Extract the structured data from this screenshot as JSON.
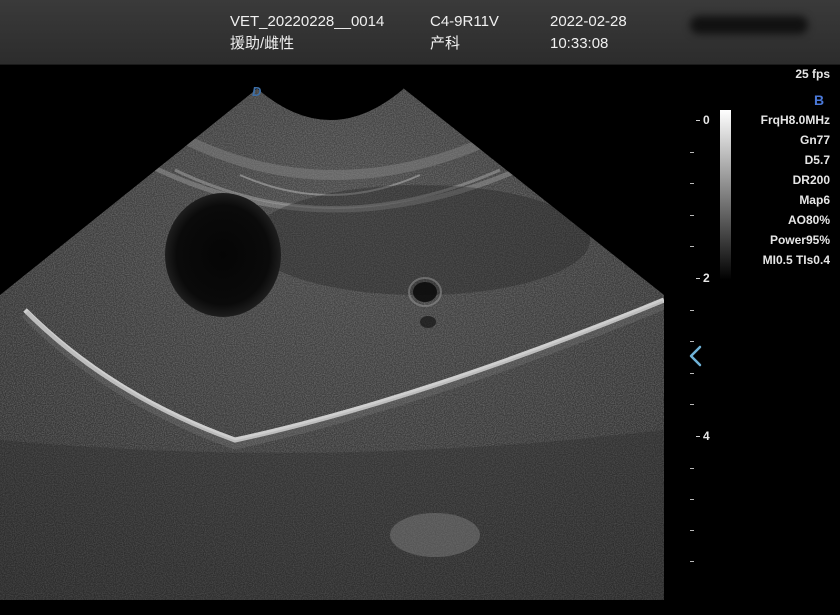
{
  "header": {
    "patient_id": "VET_20220228__0014",
    "patient_desc": "援助/雌性",
    "probe": "C4-9R11V",
    "exam_type": "产科",
    "date": "2022-02-28",
    "time": "10:33:08"
  },
  "status": {
    "fps": "25 fps",
    "mode": "B",
    "orientation_marker": "D"
  },
  "params": [
    "FrqH8.0MHz",
    "Gn77",
    "D5.7",
    "DR200",
    "Map6",
    "AO80%",
    "Power95%",
    "MI0.5 TIs0.4"
  ],
  "depth_scale": {
    "labels": [
      "0",
      "2",
      "4"
    ]
  },
  "icons": {
    "focus_marker": "chevron-left-icon"
  },
  "colors": {
    "mode_letter": "#4a78d8",
    "focus_marker": "#6fb3d8",
    "header_bg": "#333333"
  }
}
